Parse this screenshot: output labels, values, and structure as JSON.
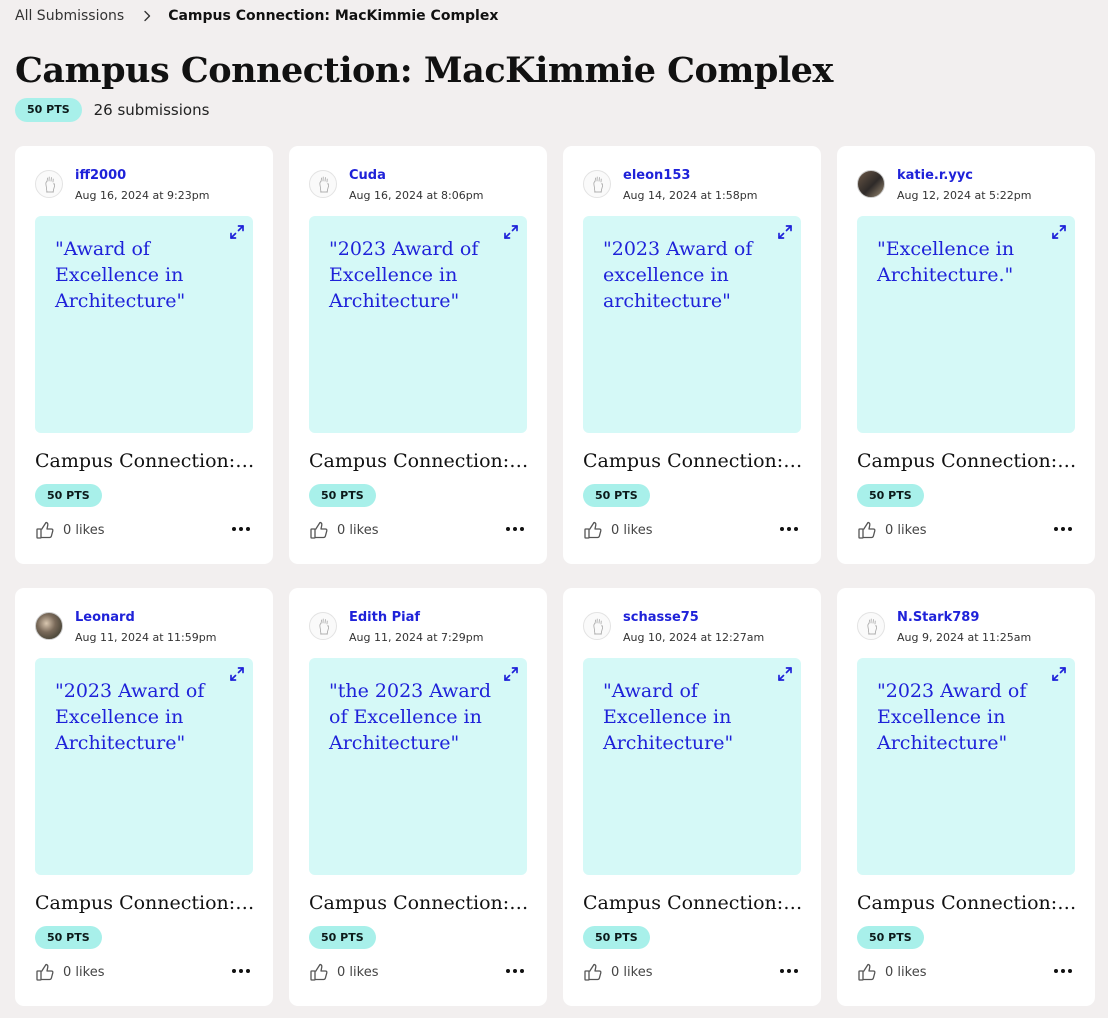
{
  "breadcrumb": {
    "parent": "All Submissions",
    "current": "Campus Connection: MacKimmie Complex"
  },
  "header": {
    "title": "Campus Connection: MacKimmie Complex",
    "points": "50 PTS",
    "submission_count": "26 submissions"
  },
  "colors": {
    "accent_blue": "#1f22d9",
    "pts_pill": "#a8f0ea",
    "preview_bg": "#d5f9f7",
    "page_bg": "#f2efef"
  },
  "cards": [
    {
      "username": "iff2000",
      "timestamp": "Aug 16, 2024 at 9:23pm",
      "preview": "\"Award of Excellence in Architecture\"",
      "title": "Campus Connection: MacKimmie Complex",
      "points": "50 PTS",
      "likes": "0 likes",
      "avatar": "hand-sketch-icon"
    },
    {
      "username": "Cuda",
      "timestamp": "Aug 16, 2024 at 8:06pm",
      "preview": "\"2023 Award of Excellence in Architecture\"",
      "title": "Campus Connection: MacKimmie Complex",
      "points": "50 PTS",
      "likes": "0 likes",
      "avatar": "hand-sketch-icon"
    },
    {
      "username": "eleon153",
      "timestamp": "Aug 14, 2024 at 1:58pm",
      "preview": "\"2023 Award of excellence in architecture\"",
      "title": "Campus Connection: MacKimmie Complex",
      "points": "50 PTS",
      "likes": "0 likes",
      "avatar": "hand-sketch-icon"
    },
    {
      "username": "katie.r.yyc",
      "timestamp": "Aug 12, 2024 at 5:22pm",
      "preview": "\"Excellence in Architecture.\"",
      "title": "Campus Connection: MacKimmie Complex",
      "points": "50 PTS",
      "likes": "0 likes",
      "avatar": "photo"
    },
    {
      "username": "Leonard",
      "timestamp": "Aug 11, 2024 at 11:59pm",
      "preview": "\"2023 Award of Excellence in Architecture\"",
      "title": "Campus Connection: MacKimmie Complex",
      "points": "50 PTS",
      "likes": "0 likes",
      "avatar": "photo"
    },
    {
      "username": "Edith Piaf",
      "timestamp": "Aug 11, 2024 at 7:29pm",
      "preview": "\"the 2023 Award of Excellence in Architecture\"",
      "title": "Campus Connection: MacKimmie Complex",
      "points": "50 PTS",
      "likes": "0 likes",
      "avatar": "hand-sketch-icon"
    },
    {
      "username": "schasse75",
      "timestamp": "Aug 10, 2024 at 12:27am",
      "preview": "\"Award of Excellence in Architecture\"",
      "title": "Campus Connection: MacKimmie Complex",
      "points": "50 PTS",
      "likes": "0 likes",
      "avatar": "hand-sketch-icon"
    },
    {
      "username": "N.Stark789",
      "timestamp": "Aug 9, 2024 at 11:25am",
      "preview": "\"2023 Award of Excellence in Architecture\"",
      "title": "Campus Connection: MacKimmie Complex",
      "points": "50 PTS",
      "likes": "0 likes",
      "avatar": "hand-sketch-icon"
    }
  ]
}
